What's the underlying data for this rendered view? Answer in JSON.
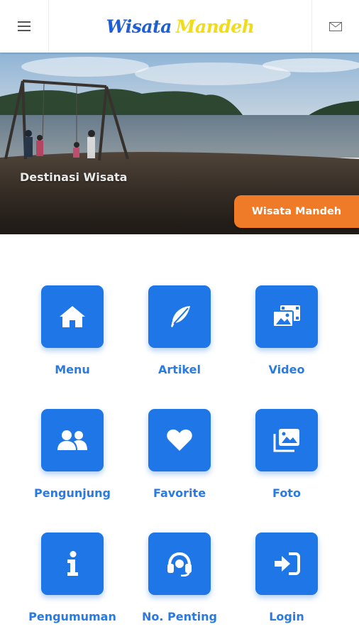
{
  "header": {
    "logo_part1": "Wisata",
    "logo_part2": "Mandeh"
  },
  "hero": {
    "caption": "Destinasi Wisata",
    "button_label": "Wisata Mandeh"
  },
  "grid": {
    "items": [
      {
        "label": "Menu",
        "icon": "home-icon"
      },
      {
        "label": "Artikel",
        "icon": "feather-icon"
      },
      {
        "label": "Video",
        "icon": "video-gallery-icon"
      },
      {
        "label": "Pengunjung",
        "icon": "users-icon"
      },
      {
        "label": "Favorite",
        "icon": "heart-icon"
      },
      {
        "label": "Foto",
        "icon": "photo-gallery-icon"
      },
      {
        "label": "Pengumuman",
        "icon": "info-icon"
      },
      {
        "label": "No. Penting",
        "icon": "headset-icon"
      },
      {
        "label": "Login",
        "icon": "login-icon"
      }
    ]
  },
  "colors": {
    "accent": "#1f76e6",
    "label": "#2a7ae2",
    "hero_button": "#ef7a27",
    "logo_blue": "#1f5fd6",
    "logo_yellow": "#f0dc1a"
  }
}
